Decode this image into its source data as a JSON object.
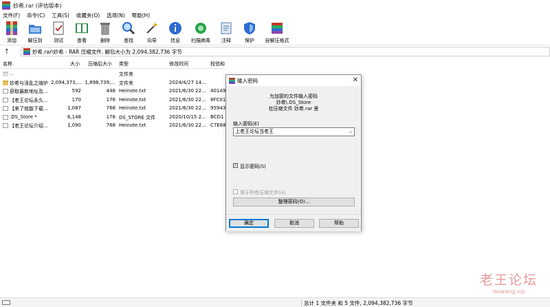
{
  "window": {
    "title": "妙希.rar (评估版本)"
  },
  "menu": [
    "文件(F)",
    "命令(C)",
    "工具(S)",
    "收藏夹(O)",
    "选项(N)",
    "帮助(H)"
  ],
  "toolbar": [
    {
      "label": "添加",
      "icon": "add-archive-icon"
    },
    {
      "label": "解压到",
      "icon": "extract-to-icon"
    },
    {
      "label": "测试",
      "icon": "test-icon"
    },
    {
      "label": "查看",
      "icon": "view-book-icon"
    },
    {
      "label": "删除",
      "icon": "trash-icon"
    },
    {
      "label": "查找",
      "icon": "magnifier-icon"
    },
    {
      "label": "向导",
      "icon": "wizard-wand-icon"
    },
    {
      "label": "信息",
      "icon": "info-icon"
    },
    {
      "label": "扫描病毒",
      "icon": "virus-scan-icon"
    },
    {
      "label": "注释",
      "icon": "comment-icon"
    },
    {
      "label": "保护",
      "icon": "shield-icon"
    },
    {
      "label": "自解压格式",
      "icon": "sfx-icon"
    }
  ],
  "address": {
    "path": "妙希.rar\\妙希 - RAR 压缩文件, 解包大小为 2,094,382,736 字节"
  },
  "columns": {
    "name": "名称",
    "size": "大小",
    "packed": "压缩后大小",
    "type": "类型",
    "modified": "修改时间",
    "crc": "校验和"
  },
  "files": [
    {
      "name": "..",
      "size": "",
      "packed": "",
      "type": "文件夹",
      "modified": "",
      "crc": "",
      "icon": "up"
    },
    {
      "name": "妙希与淫乱之熔炉",
      "size": "2,094,373,...",
      "packed": "1,898,739,...",
      "type": "文件夹",
      "modified": "2024/4/27 14...",
      "crc": "",
      "icon": "folder"
    },
    {
      "name": "获取最新地址及...",
      "size": "592",
      "packed": "448",
      "type": "Heinote.txt",
      "modified": "2021/6/30 22...",
      "crc": "401A9",
      "icon": "file"
    },
    {
      "name": "【老王论坛永久...",
      "size": "170",
      "packed": "176",
      "type": "Heinote.txt",
      "modified": "2021/6/30 22...",
      "crc": "8FC01",
      "icon": "file"
    },
    {
      "name": "【来了就能下载...",
      "size": "1,087",
      "packed": "768",
      "type": "Heinote.txt",
      "modified": "2021/6/30 22...",
      "crc": "95943",
      "icon": "file"
    },
    {
      "name": ".DS_Store *",
      "size": "6,148",
      "packed": "176",
      "type": "DS_STORE 文件",
      "modified": "2020/10/15 2...",
      "crc": "BCD1",
      "icon": "file"
    },
    {
      "name": "【老王论坛介绍...",
      "size": "1,090",
      "packed": "768",
      "type": "Heinote.txt",
      "modified": "2021/6/30 22...",
      "crc": "C7E68",
      "icon": "file"
    }
  ],
  "dialog": {
    "title": "输入密码",
    "message_line1": "为加密的文件输入密码",
    "message_line2": "妙希\\.DS_Store",
    "message_line3": "在压缩文件 妙希.rar 里",
    "password_label": "输入密码(E)",
    "password_value": "上老王论坛当老王",
    "show_password_label": "显示密码(S)",
    "show_password_checked": true,
    "use_all_label": "用于所有压缩文件(A)",
    "manage_label": "整理密码(O)...",
    "ok_label": "确定",
    "cancel_label": "取消",
    "help_label": "帮助"
  },
  "status": {
    "text": "总计 1 文件夹 和 5 文件, 2,094,382,736 字节"
  },
  "watermark": {
    "main": "老王论坛",
    "sub": "laowang.vip"
  }
}
